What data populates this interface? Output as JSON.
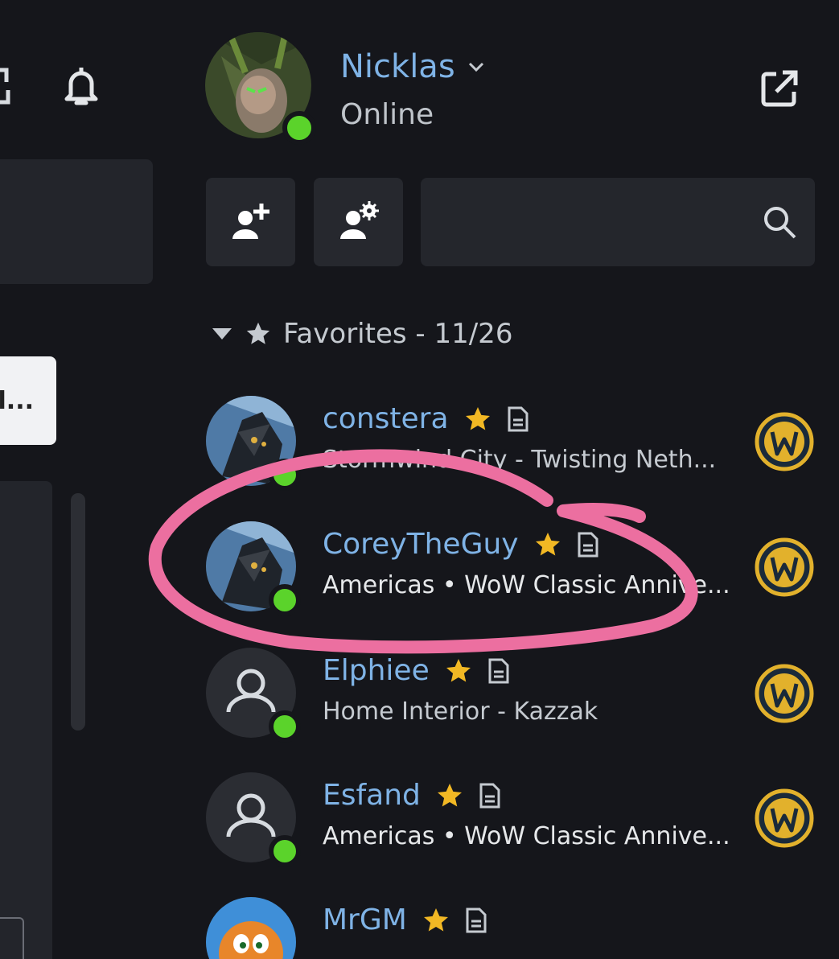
{
  "header": {
    "user_name": "Nicklas",
    "status": "Online"
  },
  "left": {
    "chip_text": "l..."
  },
  "search": {
    "placeholder": ""
  },
  "group": {
    "label": "Favorites - 11/26"
  },
  "friends": [
    {
      "name": "constera",
      "activity": "Stormwind City - Twisting Neth...",
      "avatar": "dark-dragon",
      "status": "online",
      "game": "wow-icon"
    },
    {
      "name": "CoreyTheGuy",
      "activity": "Americas • WoW Classic Annive...",
      "avatar": "dark-dragon",
      "status": "online",
      "game": "wow-icon"
    },
    {
      "name": "Elphiee",
      "activity": "Home Interior - Kazzak",
      "avatar": "default-user",
      "status": "online",
      "game": "wow-icon"
    },
    {
      "name": "Esfand",
      "activity": "Americas • WoW Classic Annive...",
      "avatar": "default-user",
      "status": "online",
      "game": "wow-icon"
    },
    {
      "name": "MrGM",
      "activity": "",
      "avatar": "crash",
      "status": "online",
      "game": ""
    }
  ],
  "colors": {
    "background": "#15161b",
    "online": "#5bd32b",
    "name": "#7fb3e6",
    "star": "#f2b824",
    "highlight": "#ec6fa0"
  }
}
